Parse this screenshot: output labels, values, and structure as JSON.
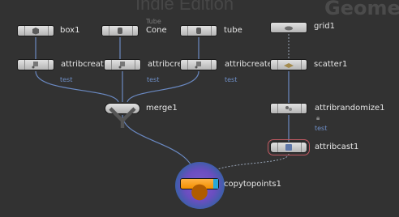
{
  "watermarks": {
    "edition": "Indie Edition",
    "context": "Geome"
  },
  "nodes": {
    "box1": {
      "label": "box1"
    },
    "cone": {
      "label": "Cone",
      "comment": "Tube"
    },
    "tube": {
      "label": "tube"
    },
    "grid1": {
      "label": "grid1"
    },
    "attribcreate_a": {
      "label": "attribcreat",
      "sub": "test"
    },
    "attribcreate_b": {
      "label": "attribcre",
      "sub": "test"
    },
    "attribcreate_c": {
      "label": "attribcreate",
      "sub": "test"
    },
    "scatter1": {
      "label": "scatter1"
    },
    "merge1": {
      "label": "merge1"
    },
    "attribrandomize1": {
      "label": "attribrandomize1",
      "sub": "test"
    },
    "attribcast1": {
      "label": "attribcast1"
    },
    "copytopoints1": {
      "label": "copytopoints1"
    }
  },
  "colors": {
    "wire": "#6a89c2",
    "wire_dotted": "#9aa6b8",
    "selection": "#c25a62",
    "copy_orange": "#f28f00",
    "display_flag": "#2aa8d8"
  }
}
